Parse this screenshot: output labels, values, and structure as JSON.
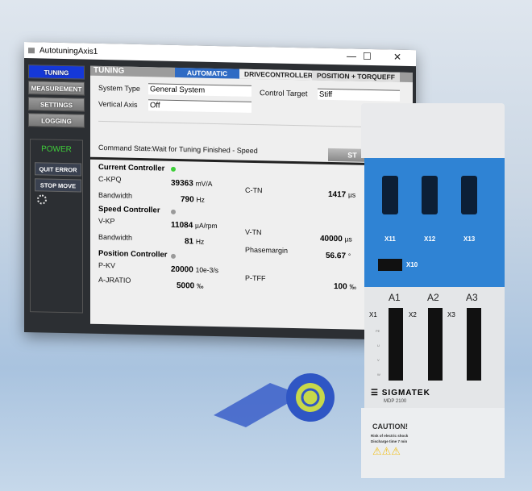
{
  "window": {
    "title": "AutotuningAxis1",
    "minimize": "—",
    "maximize": "☐",
    "close": "✕"
  },
  "sidebar": {
    "items": [
      {
        "label": "TUNING"
      },
      {
        "label": "MEASUREMENT"
      },
      {
        "label": "SETTINGS"
      },
      {
        "label": "LOGGING"
      }
    ],
    "power": "POWER",
    "quit_error": "QUIT ERROR",
    "stop_move": "STOP MOVE"
  },
  "main": {
    "heading": "TUNING",
    "tabs": [
      {
        "label": "AUTOMATIC"
      },
      {
        "label": "DRIVECONTROLLER"
      },
      {
        "label": "POSITION + TORQUEFF"
      }
    ],
    "system_type_label": "System Type",
    "system_type": "General System",
    "vertical_axis_label": "Vertical Axis",
    "vertical_axis": "Off",
    "control_target_label": "Control Target",
    "control_target": "Stiff",
    "command_state_label": "Command State:",
    "command_state": "Wait for Tuning Finished - Speed",
    "start_button": "ST"
  },
  "current": {
    "title": "Current Controller",
    "status_color": "#3fcf3a",
    "ckpq_label": "C-KPQ",
    "ckpq": "39363",
    "ckpq_unit": "mV/A",
    "ctn_label": "C-TN",
    "ctn": "1417",
    "ctn_unit": "µs",
    "bw_label": "Bandwidth",
    "bw": "790",
    "bw_unit": "Hz"
  },
  "speed": {
    "title": "Speed Controller",
    "status_color": "#9a9a9a",
    "vkp_label": "V-KP",
    "vkp": "11084",
    "vkp_unit": "µA/rpm",
    "vtn_label": "V-TN",
    "vtn": "40000",
    "vtn_unit": "µs",
    "bw_label": "Bandwidth",
    "bw": "81",
    "bw_unit": "Hz",
    "pm_label": "Phasemargin",
    "pm": "56.67",
    "pm_unit": "°"
  },
  "position": {
    "title": "Position Controller",
    "status_color": "#9a9a9a",
    "pkv_label": "P-KV",
    "pkv": "20000",
    "pkv_unit": "10e-3/s",
    "ptff_label": "P-TFF",
    "ptff": "100",
    "ptff_unit": "‰",
    "aj_label": "A-JRATIO",
    "aj": "5000",
    "aj_unit": "‰"
  },
  "device": {
    "ports": [
      "X11",
      "X12",
      "X13"
    ],
    "x10": "X10",
    "axes": [
      "A1",
      "A2",
      "A3"
    ],
    "terminals": [
      "X1",
      "X2",
      "X3"
    ],
    "pins": [
      "PE",
      "U",
      "V",
      "W"
    ],
    "brand": "SIGMATEK",
    "model": "MDP 2100",
    "caution": "CAUTION!",
    "warning1": "Risk of electric shock",
    "warning2": "Discharge time 7 min"
  }
}
